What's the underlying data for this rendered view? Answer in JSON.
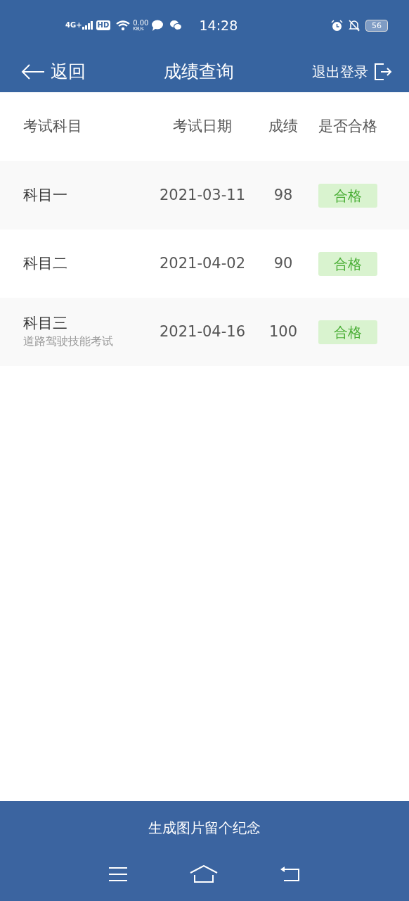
{
  "status_bar": {
    "network": "4G+",
    "hd": "HD",
    "speed_value": "0.00",
    "speed_unit": "KB/s",
    "time": "14:28",
    "battery": "56"
  },
  "nav": {
    "back": "返回",
    "title": "成绩查询",
    "logout": "退出登录"
  },
  "table": {
    "columns": [
      "考试科目",
      "考试日期",
      "成绩",
      "是否合格"
    ],
    "rows": [
      {
        "subject": "科目一",
        "date": "2021-03-11",
        "score": "98",
        "result": "合格",
        "passed": true
      },
      {
        "subject": "科目二",
        "date": "2021-04-02",
        "score": "90",
        "result": "合格",
        "passed": true
      },
      {
        "subject": "科目三",
        "note": "道路驾驶技能考试",
        "date": "2021-04-16",
        "score": "100",
        "result": "合格",
        "passed": true
      }
    ]
  },
  "bottom_button": "生成图片留个纪念"
}
